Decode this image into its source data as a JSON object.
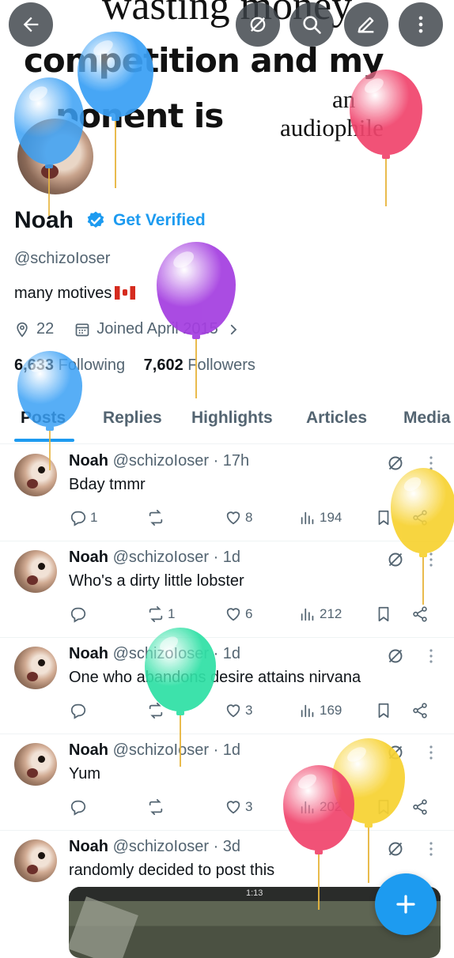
{
  "banner": {
    "line1": "wasting money",
    "line2": "competition and my",
    "line3": "ponent is",
    "side_top": "an",
    "side_bottom": "audiophile"
  },
  "top_bar": {
    "back_icon": "arrow-left-icon",
    "grok_icon": "grok-icon",
    "search_icon": "search-icon",
    "edit_icon": "pencil-icon",
    "more_icon": "more-vertical-icon"
  },
  "profile": {
    "name": "Noah",
    "get_verified": "Get Verified",
    "handle": "@schizoIoser",
    "bio": "many motives",
    "location": "22",
    "joined": "Joined April 2015",
    "following_count": "6,633",
    "following_label": "Following",
    "followers_count": "7,602",
    "followers_label": "Followers"
  },
  "tabs": [
    {
      "label": "Posts"
    },
    {
      "label": "Replies"
    },
    {
      "label": "Highlights"
    },
    {
      "label": "Articles"
    },
    {
      "label": "Media"
    }
  ],
  "posts": [
    {
      "name": "Noah",
      "meta": "@schizoIoser · 17h",
      "text": "Bday tmmr",
      "replies": "1",
      "reposts": "",
      "likes": "8",
      "views": "194"
    },
    {
      "name": "Noah",
      "meta": "@schizoIoser · 1d",
      "text": "Who's a dirty little lobster",
      "replies": "",
      "reposts": "1",
      "likes": "6",
      "views": "212"
    },
    {
      "name": "Noah",
      "meta": "@schizoIoser · 1d",
      "text": "One who abandons desire attains nirvana",
      "replies": "",
      "reposts": "",
      "likes": "3",
      "views": "169"
    },
    {
      "name": "Noah",
      "meta": "@schizoIoser · 1d",
      "text": "Yum",
      "replies": "",
      "reposts": "",
      "likes": "3",
      "views": "202"
    },
    {
      "name": "Noah",
      "meta": "@schizoIoser · 3d",
      "text": "randomly decided to post this",
      "replies": "",
      "reposts": "",
      "likes": "",
      "views": ""
    }
  ],
  "media_hud": "1:13",
  "colors": {
    "accent": "#1d9bf0",
    "balloon_blue": "#3aa0f5",
    "balloon_red": "#f0456d",
    "balloon_purple": "#a43ee0",
    "balloon_yellow": "#f7d232",
    "balloon_teal": "#2fe0a5"
  }
}
